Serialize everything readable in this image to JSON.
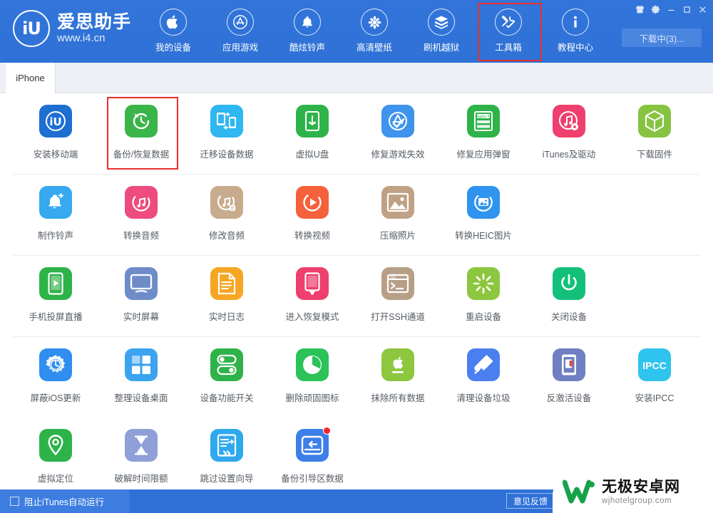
{
  "window": {
    "controls": [
      {
        "name": "skin-icon",
        "glyph": "shirt"
      },
      {
        "name": "settings-gear-icon",
        "glyph": "gear"
      },
      {
        "name": "minimize-icon",
        "glyph": "minimize"
      },
      {
        "name": "maximize-icon",
        "glyph": "maximize"
      },
      {
        "name": "close-icon",
        "glyph": "close"
      }
    ]
  },
  "brand": {
    "mark": "iU",
    "title": "爱思助手",
    "url": "www.i4.cn"
  },
  "nav": {
    "items": [
      {
        "label": "我的设备",
        "icon": "apple-icon",
        "selected": false
      },
      {
        "label": "应用游戏",
        "icon": "appstore-icon",
        "selected": false
      },
      {
        "label": "酷炫铃声",
        "icon": "bell-icon",
        "selected": false
      },
      {
        "label": "高清壁纸",
        "icon": "flower-icon",
        "selected": false
      },
      {
        "label": "刷机越狱",
        "icon": "box-open-icon",
        "selected": false
      },
      {
        "label": "工具箱",
        "icon": "tools-icon",
        "selected": true
      },
      {
        "label": "教程中心",
        "icon": "info-icon",
        "selected": false
      }
    ]
  },
  "download_button": {
    "label": "下载中(3)..."
  },
  "tabs": [
    {
      "label": "iPhone",
      "active": true
    }
  ],
  "toolbox": {
    "rows": [
      {
        "tiles": [
          {
            "label": "安装移动端",
            "icon": "i4-app-icon",
            "color": "#1d6fd0",
            "selected": false,
            "badge": false
          },
          {
            "label": "备份/恢复数据",
            "icon": "backup-restore-icon",
            "color": "#3ab54a",
            "selected": true,
            "badge": false
          },
          {
            "label": "迁移设备数据",
            "icon": "migrate-data-icon",
            "color": "#2eb7f0",
            "selected": false,
            "badge": false
          },
          {
            "label": "虚拟U盘",
            "icon": "usb-drive-icon",
            "color": "#2eb34a",
            "selected": false,
            "badge": false
          },
          {
            "label": "修复游戏失效",
            "icon": "fix-game-icon",
            "color": "#3e93ec",
            "selected": false,
            "badge": false
          },
          {
            "label": "修复应用弹窗",
            "icon": "fix-appleid-popup-icon",
            "color": "#2eb34a",
            "selected": false,
            "badge": false
          },
          {
            "label": "iTunes及驱动",
            "icon": "itunes-driver-icon",
            "color": "#ef3f6e",
            "selected": false,
            "badge": false
          },
          {
            "label": "下载固件",
            "icon": "download-firmware-icon",
            "color": "#86c341",
            "selected": false,
            "badge": false
          }
        ]
      },
      {
        "tiles": [
          {
            "label": "制作铃声",
            "icon": "make-ringtone-icon",
            "color": "#36a9f0",
            "selected": false,
            "badge": false
          },
          {
            "label": "转换音频",
            "icon": "convert-audio-icon",
            "color": "#ee4b7f",
            "selected": false,
            "badge": false
          },
          {
            "label": "修改音频",
            "icon": "edit-audio-icon",
            "color": "#c8ab8d",
            "selected": false,
            "badge": false
          },
          {
            "label": "转换视频",
            "icon": "convert-video-icon",
            "color": "#f4613b",
            "selected": false,
            "badge": false
          },
          {
            "label": "压缩照片",
            "icon": "compress-photo-icon",
            "color": "#c0a184",
            "selected": false,
            "badge": false
          },
          {
            "label": "转换HEIC图片",
            "icon": "convert-heic-icon",
            "color": "#2f93ef",
            "selected": false,
            "badge": false
          }
        ]
      },
      {
        "tiles": [
          {
            "label": "手机投屏直播",
            "icon": "screen-cast-icon",
            "color": "#2eb34a",
            "selected": false,
            "badge": false
          },
          {
            "label": "实时屏幕",
            "icon": "realtime-screen-icon",
            "color": "#6d8cc8",
            "selected": false,
            "badge": false
          },
          {
            "label": "实时日志",
            "icon": "realtime-log-icon",
            "color": "#f6a623",
            "selected": false,
            "badge": false
          },
          {
            "label": "进入恢复模式",
            "icon": "recovery-mode-icon",
            "color": "#ee3f6e",
            "selected": false,
            "badge": false
          },
          {
            "label": "打开SSH通道",
            "icon": "ssh-tunnel-icon",
            "color": "#b79f87",
            "selected": false,
            "badge": false
          },
          {
            "label": "重启设备",
            "icon": "restart-device-icon",
            "color": "#8dc63f",
            "selected": false,
            "badge": false
          },
          {
            "label": "关闭设备",
            "icon": "shutdown-device-icon",
            "color": "#12c07a",
            "selected": false,
            "badge": false
          }
        ]
      },
      {
        "tiles": [
          {
            "label": "屏蔽iOS更新",
            "icon": "block-ios-update-icon",
            "color": "#2f8ef0",
            "selected": false,
            "badge": false
          },
          {
            "label": "整理设备桌面",
            "icon": "arrange-desktop-icon",
            "color": "#3ba3f0",
            "selected": false,
            "badge": false
          },
          {
            "label": "设备功能开关",
            "icon": "feature-toggle-icon",
            "color": "#2eb34a",
            "selected": false,
            "badge": false
          },
          {
            "label": "删除顽固图标",
            "icon": "remove-stubborn-icon",
            "color": "#2bc257",
            "selected": false,
            "badge": false
          },
          {
            "label": "抹除所有数据",
            "icon": "erase-all-data-icon",
            "color": "#8dc63f",
            "selected": false,
            "badge": false
          },
          {
            "label": "清理设备垃圾",
            "icon": "clean-junk-icon",
            "color": "#4a7ff0",
            "selected": false,
            "badge": false
          },
          {
            "label": "反激活设备",
            "icon": "deactivate-device-icon",
            "color": "#6f7fc2",
            "selected": false,
            "badge": false
          },
          {
            "label": "安装IPCC",
            "icon": "install-ipcc-icon",
            "color": "#2ec4ee",
            "selected": false,
            "badge": false,
            "text": "IPCC"
          }
        ]
      },
      {
        "tiles": [
          {
            "label": "虚拟定位",
            "icon": "virtual-location-icon",
            "color": "#2eb34a",
            "selected": false,
            "badge": false
          },
          {
            "label": "破解时间限额",
            "icon": "crack-screentime-icon",
            "color": "#8f9fd8",
            "selected": false,
            "badge": false
          },
          {
            "label": "跳过设置向导",
            "icon": "skip-setup-icon",
            "color": "#2fa9ee",
            "selected": false,
            "badge": false
          },
          {
            "label": "备份引导区数据",
            "icon": "backup-boot-data-icon",
            "color": "#3d7fe8",
            "selected": false,
            "badge": true
          }
        ]
      }
    ]
  },
  "statusbar": {
    "block_itunes_label": "阻止iTunes自动运行",
    "block_itunes_checked": false,
    "feedback_label": "意见反馈"
  },
  "watermark": {
    "title": "无极安卓网",
    "url": "wjhotelgroup.com"
  },
  "colors": {
    "header_blue": "#2f71d6",
    "selection_red": "#e8302a",
    "tab_bg": "#eceff3",
    "badge_red": "#f5222d"
  }
}
